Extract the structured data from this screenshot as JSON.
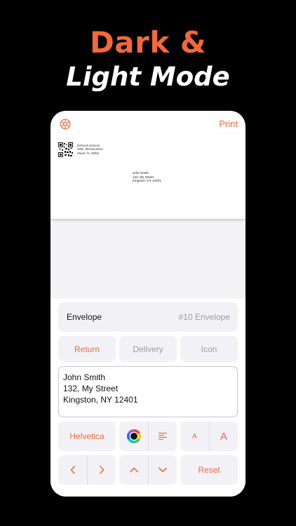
{
  "headline": {
    "line1": "Dark &",
    "line2": "Light Mode"
  },
  "toolbar": {
    "settings_icon": "gear-icon",
    "print_label": "Print"
  },
  "envelope_preview": {
    "return_address": [
      "Deborah Dickens",
      "3280, Elkview Drive",
      "Stuart, FL 34994"
    ],
    "delivery_address": [
      "John Smith",
      "132, My Street",
      "Kingston, NY 12401"
    ]
  },
  "envelope_row": {
    "label": "Envelope",
    "value": "#10 Envelope"
  },
  "segments": [
    {
      "label": "Return",
      "selected": true
    },
    {
      "label": "Delivery",
      "selected": false
    },
    {
      "label": "Icon",
      "selected": false
    }
  ],
  "address_text": {
    "line1": "John Smith",
    "line2": "132, My Street",
    "line3": "Kingston, NY 12401"
  },
  "font_controls": {
    "font_label": "Helvetica",
    "color_icon": "color-wheel-icon",
    "align_icon": "align-left-icon",
    "decrease_label": "A",
    "increase_label": "A"
  },
  "nav_controls": {
    "left_icon": "chevron-left-icon",
    "right_icon": "chevron-right-icon",
    "up_icon": "chevron-up-icon",
    "down_icon": "chevron-down-icon",
    "reset_label": "Reset"
  },
  "colors": {
    "accent": "#f4683b",
    "background": "#000000",
    "button_bg": "#f2f2f6",
    "muted_text": "#9a9aa0"
  }
}
